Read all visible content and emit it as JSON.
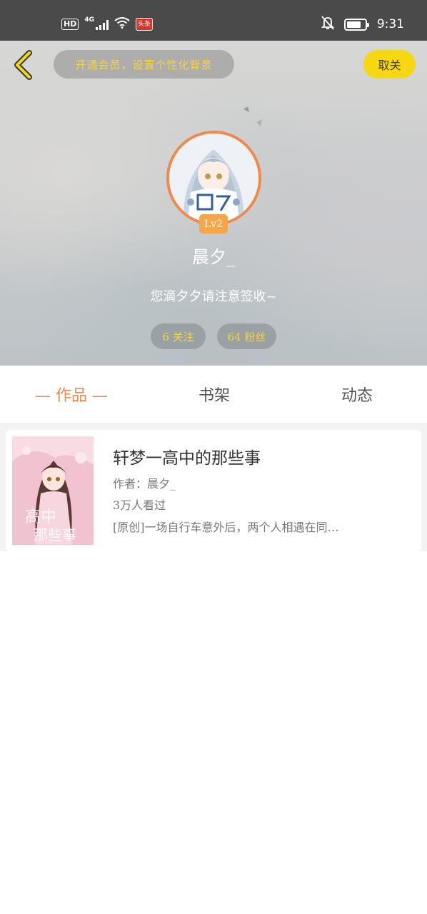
{
  "status_bar": {
    "hd": "HD",
    "network": "4G",
    "app_badge": "头条",
    "battery_percent": 80,
    "time": "9:31"
  },
  "header": {
    "vip_prompt": "开通会员，设置个性化背景",
    "unfollow_label": "取关",
    "level": "Lv2",
    "username": "晨夕_",
    "bio": "您滴夕夕请注意签收~",
    "following": "6 关注",
    "followers": "64 粉丝"
  },
  "tabs": {
    "works": "— 作品 —",
    "shelf": "书架",
    "feed": "动态"
  },
  "books": [
    {
      "title": "轩梦一高中的那些事",
      "author": "作者：晨夕_",
      "views": "3万人看过",
      "description": "[原创]一场自行车意外后，两个人相遇在同…"
    }
  ],
  "colors": {
    "accent_orange": "#f08a4b",
    "unfollow_yellow": "#f5d712",
    "pill_text_gold": "#f2d34a",
    "level_badge": "#f5a54a"
  }
}
